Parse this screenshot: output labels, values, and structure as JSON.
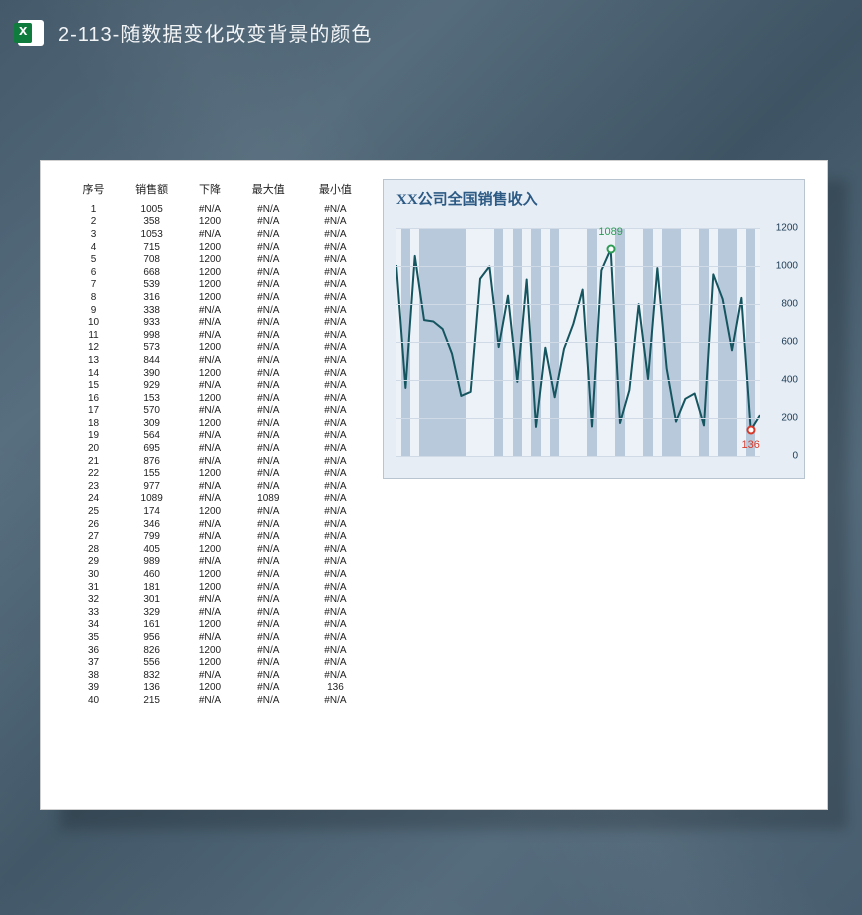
{
  "window": {
    "title": "2-113-随数据变化改变背景的颜色",
    "icon": "excel-icon"
  },
  "table": {
    "headers": [
      "序号",
      "销售额",
      "下降",
      "最大值",
      "最小值"
    ],
    "na": "#N/A",
    "rows": [
      {
        "idx": 1,
        "sales": 1005,
        "down": "#N/A",
        "max": "#N/A",
        "min": "#N/A"
      },
      {
        "idx": 2,
        "sales": 358,
        "down": 1200,
        "max": "#N/A",
        "min": "#N/A"
      },
      {
        "idx": 3,
        "sales": 1053,
        "down": "#N/A",
        "max": "#N/A",
        "min": "#N/A"
      },
      {
        "idx": 4,
        "sales": 715,
        "down": 1200,
        "max": "#N/A",
        "min": "#N/A"
      },
      {
        "idx": 5,
        "sales": 708,
        "down": 1200,
        "max": "#N/A",
        "min": "#N/A"
      },
      {
        "idx": 6,
        "sales": 668,
        "down": 1200,
        "max": "#N/A",
        "min": "#N/A"
      },
      {
        "idx": 7,
        "sales": 539,
        "down": 1200,
        "max": "#N/A",
        "min": "#N/A"
      },
      {
        "idx": 8,
        "sales": 316,
        "down": 1200,
        "max": "#N/A",
        "min": "#N/A"
      },
      {
        "idx": 9,
        "sales": 338,
        "down": "#N/A",
        "max": "#N/A",
        "min": "#N/A"
      },
      {
        "idx": 10,
        "sales": 933,
        "down": "#N/A",
        "max": "#N/A",
        "min": "#N/A"
      },
      {
        "idx": 11,
        "sales": 998,
        "down": "#N/A",
        "max": "#N/A",
        "min": "#N/A"
      },
      {
        "idx": 12,
        "sales": 573,
        "down": 1200,
        "max": "#N/A",
        "min": "#N/A"
      },
      {
        "idx": 13,
        "sales": 844,
        "down": "#N/A",
        "max": "#N/A",
        "min": "#N/A"
      },
      {
        "idx": 14,
        "sales": 390,
        "down": 1200,
        "max": "#N/A",
        "min": "#N/A"
      },
      {
        "idx": 15,
        "sales": 929,
        "down": "#N/A",
        "max": "#N/A",
        "min": "#N/A"
      },
      {
        "idx": 16,
        "sales": 153,
        "down": 1200,
        "max": "#N/A",
        "min": "#N/A"
      },
      {
        "idx": 17,
        "sales": 570,
        "down": "#N/A",
        "max": "#N/A",
        "min": "#N/A"
      },
      {
        "idx": 18,
        "sales": 309,
        "down": 1200,
        "max": "#N/A",
        "min": "#N/A"
      },
      {
        "idx": 19,
        "sales": 564,
        "down": "#N/A",
        "max": "#N/A",
        "min": "#N/A"
      },
      {
        "idx": 20,
        "sales": 695,
        "down": "#N/A",
        "max": "#N/A",
        "min": "#N/A"
      },
      {
        "idx": 21,
        "sales": 876,
        "down": "#N/A",
        "max": "#N/A",
        "min": "#N/A"
      },
      {
        "idx": 22,
        "sales": 155,
        "down": 1200,
        "max": "#N/A",
        "min": "#N/A"
      },
      {
        "idx": 23,
        "sales": 977,
        "down": "#N/A",
        "max": "#N/A",
        "min": "#N/A"
      },
      {
        "idx": 24,
        "sales": 1089,
        "down": "#N/A",
        "max": 1089,
        "min": "#N/A"
      },
      {
        "idx": 25,
        "sales": 174,
        "down": 1200,
        "max": "#N/A",
        "min": "#N/A"
      },
      {
        "idx": 26,
        "sales": 346,
        "down": "#N/A",
        "max": "#N/A",
        "min": "#N/A"
      },
      {
        "idx": 27,
        "sales": 799,
        "down": "#N/A",
        "max": "#N/A",
        "min": "#N/A"
      },
      {
        "idx": 28,
        "sales": 405,
        "down": 1200,
        "max": "#N/A",
        "min": "#N/A"
      },
      {
        "idx": 29,
        "sales": 989,
        "down": "#N/A",
        "max": "#N/A",
        "min": "#N/A"
      },
      {
        "idx": 30,
        "sales": 460,
        "down": 1200,
        "max": "#N/A",
        "min": "#N/A"
      },
      {
        "idx": 31,
        "sales": 181,
        "down": 1200,
        "max": "#N/A",
        "min": "#N/A"
      },
      {
        "idx": 32,
        "sales": 301,
        "down": "#N/A",
        "max": "#N/A",
        "min": "#N/A"
      },
      {
        "idx": 33,
        "sales": 329,
        "down": "#N/A",
        "max": "#N/A",
        "min": "#N/A"
      },
      {
        "idx": 34,
        "sales": 161,
        "down": 1200,
        "max": "#N/A",
        "min": "#N/A"
      },
      {
        "idx": 35,
        "sales": 956,
        "down": "#N/A",
        "max": "#N/A",
        "min": "#N/A"
      },
      {
        "idx": 36,
        "sales": 826,
        "down": 1200,
        "max": "#N/A",
        "min": "#N/A"
      },
      {
        "idx": 37,
        "sales": 556,
        "down": 1200,
        "max": "#N/A",
        "min": "#N/A"
      },
      {
        "idx": 38,
        "sales": 832,
        "down": "#N/A",
        "max": "#N/A",
        "min": "#N/A"
      },
      {
        "idx": 39,
        "sales": 136,
        "down": 1200,
        "max": "#N/A",
        "min": 136
      },
      {
        "idx": 40,
        "sales": 215,
        "down": "#N/A",
        "max": "#N/A",
        "min": "#N/A"
      }
    ]
  },
  "chart_data": {
    "type": "line",
    "title": "XX公司全国销售收入",
    "xlabel": "",
    "ylabel": "",
    "ylim": [
      0,
      1200
    ],
    "yticks": [
      0,
      200,
      400,
      600,
      800,
      1000,
      1200
    ],
    "x": [
      1,
      2,
      3,
      4,
      5,
      6,
      7,
      8,
      9,
      10,
      11,
      12,
      13,
      14,
      15,
      16,
      17,
      18,
      19,
      20,
      21,
      22,
      23,
      24,
      25,
      26,
      27,
      28,
      29,
      30,
      31,
      32,
      33,
      34,
      35,
      36,
      37,
      38,
      39,
      40
    ],
    "series": [
      {
        "name": "销售额",
        "values": [
          1005,
          358,
          1053,
          715,
          708,
          668,
          539,
          316,
          338,
          933,
          998,
          573,
          844,
          390,
          929,
          153,
          570,
          309,
          564,
          695,
          876,
          155,
          977,
          1089,
          174,
          346,
          799,
          405,
          989,
          460,
          181,
          301,
          329,
          161,
          956,
          826,
          556,
          832,
          136,
          215
        ],
        "color": "#15555f"
      }
    ],
    "background_bars": {
      "description": "full-height bars at x-positions where 下降==1200 (value decreased vs prior)",
      "x": [
        2,
        4,
        5,
        6,
        7,
        8,
        12,
        14,
        16,
        18,
        22,
        25,
        28,
        30,
        31,
        34,
        36,
        37,
        39
      ],
      "color": "#b9c9dc"
    },
    "annotations": [
      {
        "kind": "max",
        "x": 24,
        "y": 1089,
        "label": "1089",
        "color": "#2e9b55"
      },
      {
        "kind": "min",
        "x": 39,
        "y": 136,
        "label": "136",
        "color": "#d83a2a"
      }
    ]
  },
  "colors": {
    "sheet_bg": "#ffffff",
    "chart_bg": "#e6edf5",
    "plot_bg": "#edf2f8",
    "line": "#15555f",
    "bar": "#b9c9dc"
  }
}
